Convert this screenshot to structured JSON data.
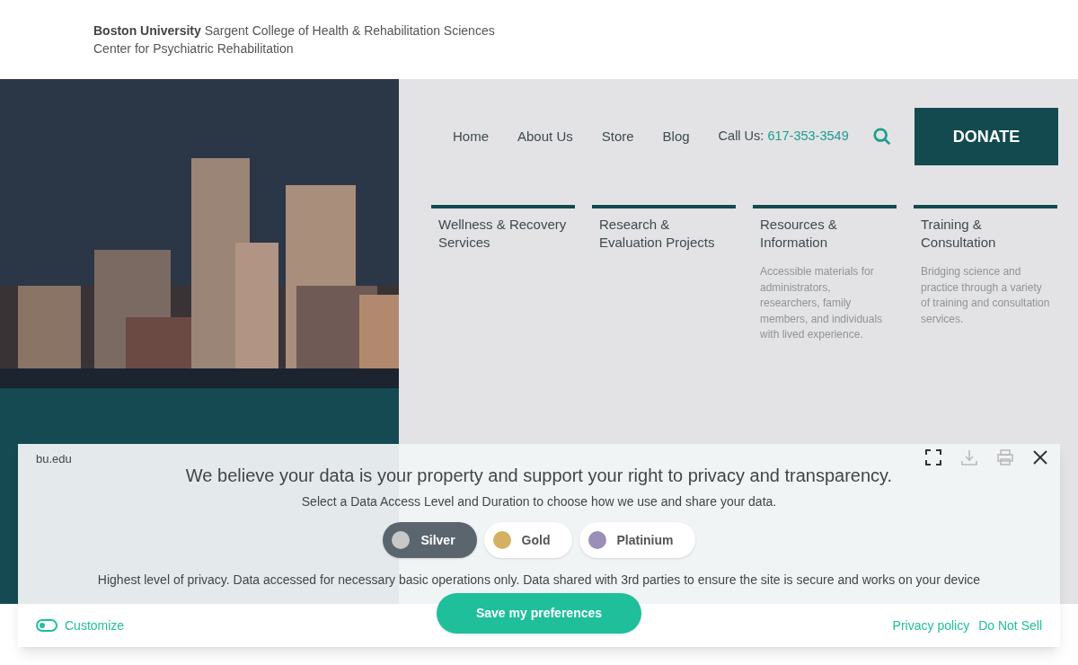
{
  "header": {
    "university": "Boston University",
    "college": "Sargent College of Health & Rehabilitation Sciences",
    "center": "Center for Psychiatric Rehabilitation"
  },
  "nav": {
    "links": [
      "Home",
      "About Us",
      "Store",
      "Blog"
    ],
    "call_label": "Call Us:",
    "phone": "617-353-3549",
    "donate": "DONATE"
  },
  "sections": [
    {
      "title": "Wellness & Recovery Services"
    },
    {
      "title": "Research & Evaluation Projects"
    },
    {
      "title": "Resources & Information",
      "description": "Accessible materials for administrators, researchers, family members, and individuals with lived experience."
    },
    {
      "title": "Training & Consultation",
      "description": "Bridging science and practice through a variety of training and consultation services."
    }
  ],
  "consent": {
    "site": "bu.edu",
    "heading": "We believe your data is your property and support your right to privacy and transparency.",
    "subheading": "Select a Data Access Level and Duration to choose how we use and share your data.",
    "levels": [
      {
        "label": "Silver",
        "selected": true,
        "color": "#c8c8c8"
      },
      {
        "label": "Gold",
        "selected": false,
        "color": "#d4b062"
      },
      {
        "label": "Platinium",
        "selected": false,
        "color": "#9b8fb8"
      }
    ],
    "description": "Highest level of privacy. Data accessed for necessary basic operations only. Data shared with 3rd parties to ensure the site is secure and works on your device",
    "save": "Save my preferences",
    "customize": {
      "label": "Customize",
      "on": false
    },
    "links": [
      "Privacy policy",
      "Do Not Sell"
    ]
  }
}
